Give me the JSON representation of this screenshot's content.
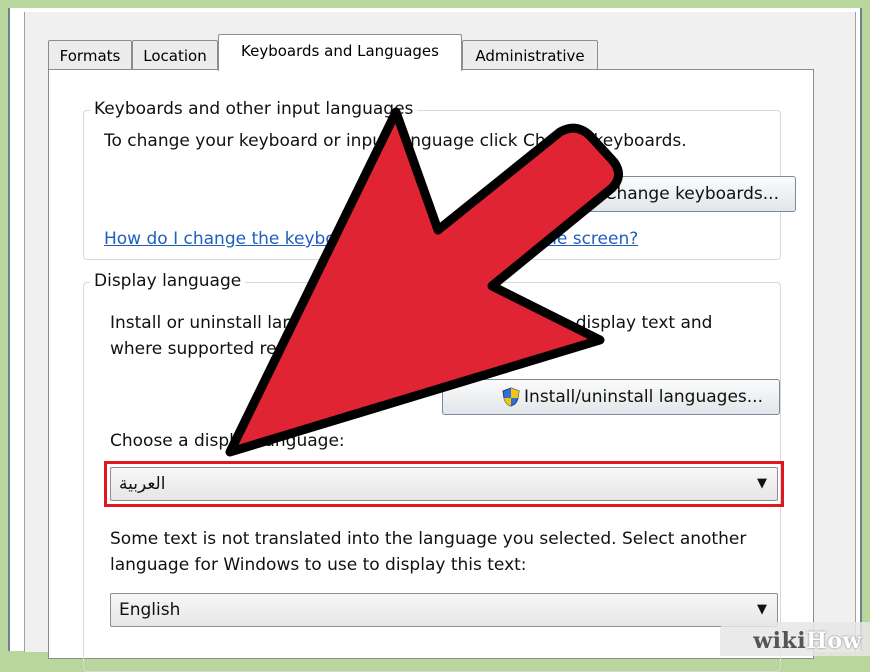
{
  "tabs": [
    {
      "label": "Formats"
    },
    {
      "label": "Location"
    },
    {
      "label": "Keyboards and Languages"
    },
    {
      "label": "Administrative"
    }
  ],
  "keyboards_group": {
    "title": "Keyboards and other input languages",
    "description": "To change your keyboard or input language click Change keyboards.",
    "change_button_label": "Change keyboards...",
    "help_link": "How do I change the keyboard layout for the Welcome screen?"
  },
  "display_group": {
    "title": "Display language",
    "description_line1": "Install or uninstall languages that Windows can use to display text and",
    "description_line2": "where supported recognize speech and handwriting.",
    "install_button_label": "Install/uninstall languages...",
    "choose_label": "Choose a display language:",
    "display_language_value": "العربية",
    "note_line1": "Some text is not translated into the language you selected. Select another",
    "note_line2": "language for Windows to use to display this text:",
    "fallback_language_value": "English"
  },
  "watermark": {
    "part1": "wiki",
    "part2": "How"
  },
  "colors": {
    "highlight": "#e3161d",
    "arrow": "#e02433",
    "link": "#1f5fbf"
  }
}
